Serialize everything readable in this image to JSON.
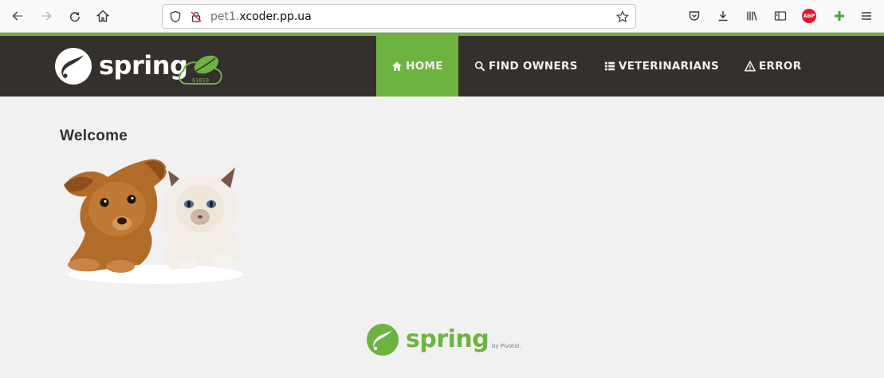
{
  "browser": {
    "url_host": "pet1.",
    "url_domain": "xcoder.pp.ua",
    "abp_label": "ABP",
    "icons": [
      "back-icon",
      "forward-icon",
      "reload-icon",
      "home-icon",
      "shield-icon",
      "insecure-lock-icon",
      "bookmark-star-icon",
      "pocket-icon",
      "download-icon",
      "library-icon",
      "sidebar-icon",
      "adblock-icon",
      "extension-icon",
      "menu-icon"
    ]
  },
  "site": {
    "brand_color": "#6db33f",
    "navbar_color": "#34302d",
    "logo_text": "spring",
    "logo_badge_text": "01010",
    "nav": [
      {
        "label": "HOME",
        "icon": "home-icon",
        "active": true
      },
      {
        "label": "FIND OWNERS",
        "icon": "search-icon",
        "active": false
      },
      {
        "label": "VETERINARIANS",
        "icon": "list-icon",
        "active": false
      },
      {
        "label": "ERROR",
        "icon": "warning-icon",
        "active": false
      }
    ],
    "heading": "Welcome",
    "footer_logo_text": "spring",
    "footer_byline": "by Pivotal."
  }
}
